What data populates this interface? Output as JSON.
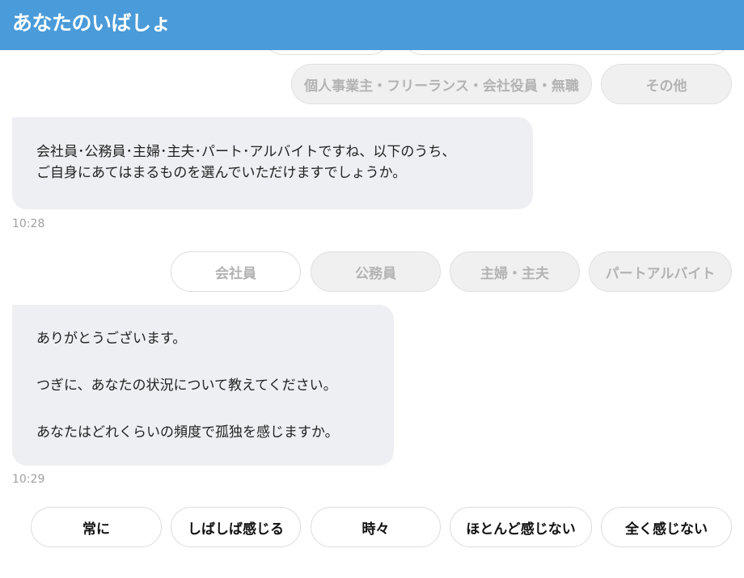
{
  "app": {
    "title": "あなたのいばしょ"
  },
  "colors": {
    "header": "#4a9bd9",
    "bubble": "#eeeff3",
    "chip_disabled": "#f0f0f0"
  },
  "occupation_options": {
    "self_employed": "個人事業主・フリーランス・会社役員・無職",
    "other": "その他"
  },
  "messages": [
    {
      "lines": [
        "会社員･公務員･主婦･主夫･パート･アルバイトですね、以下のうち、",
        "ご自身にあてはまるものを選んでいただけますでしょうか。"
      ],
      "time": "10:28"
    },
    {
      "lines": [
        "ありがとうございます。",
        "つぎに、あなたの状況について教えてください。",
        "あなたはどれくらいの頻度で孤独を感じますか。"
      ],
      "time": "10:29"
    }
  ],
  "employment_options": {
    "company_employee": "会社員",
    "civil_servant": "公務員",
    "homemaker": "主婦・主夫",
    "part_time": "パートアルバイト"
  },
  "loneliness_options": {
    "always": "常に",
    "often": "しばしば感じる",
    "sometimes": "時々",
    "rarely": "ほとんど感じない",
    "never": "全く感じない"
  }
}
